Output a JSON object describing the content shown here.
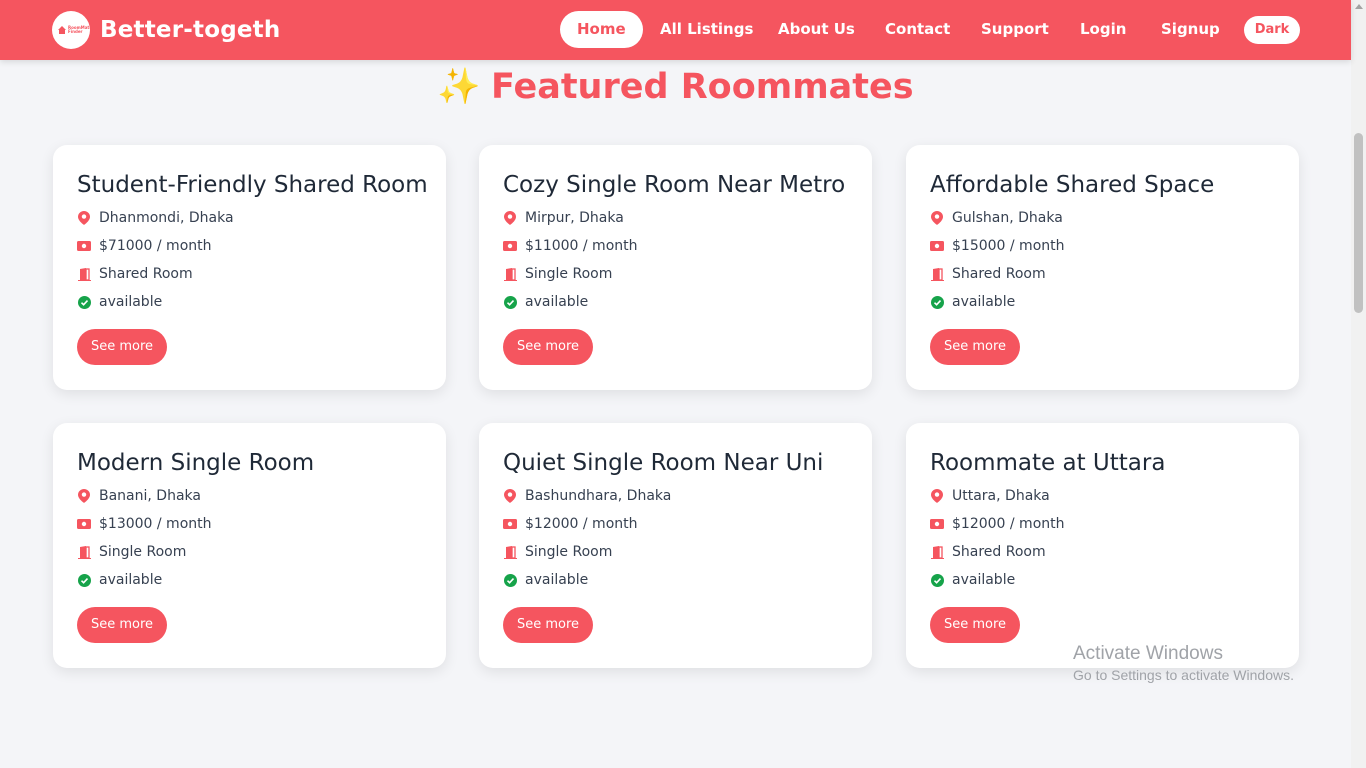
{
  "brand": {
    "name": "Better-togeth",
    "logo_text": "RoomMate Finder",
    "color": "#f5555f"
  },
  "nav": {
    "links": [
      {
        "label": "Home",
        "active": true
      },
      {
        "label": "All Listings"
      },
      {
        "label": "About Us"
      },
      {
        "label": "Contact"
      },
      {
        "label": "Support"
      },
      {
        "label": "Login"
      },
      {
        "label": "Signup"
      }
    ],
    "theme_toggle": "Dark"
  },
  "section": {
    "icon": "✨",
    "title": "Featured Roommates"
  },
  "listings": [
    {
      "title": "Student-Friendly Shared Room",
      "location": "Dhanmondi, Dhaka",
      "rent": "$71000 / month",
      "room_type": "Shared Room",
      "availability": "available",
      "button": "See more"
    },
    {
      "title": "Cozy Single Room Near Metro",
      "location": "Mirpur, Dhaka",
      "rent": "$11000 / month",
      "room_type": "Single Room",
      "availability": "available",
      "button": "See more"
    },
    {
      "title": "Affordable Shared Space",
      "location": "Gulshan, Dhaka",
      "rent": "$15000 / month",
      "room_type": "Shared Room",
      "availability": "available",
      "button": "See more"
    },
    {
      "title": "Modern Single Room",
      "location": "Banani, Dhaka",
      "rent": "$13000 / month",
      "room_type": "Single Room",
      "availability": "available",
      "button": "See more"
    },
    {
      "title": "Quiet Single Room Near Uni",
      "location": "Bashundhara, Dhaka",
      "rent": "$12000 / month",
      "room_type": "Single Room",
      "availability": "available",
      "button": "See more"
    },
    {
      "title": "Roommate at Uttara",
      "location": "Uttara, Dhaka",
      "rent": "$12000 / month",
      "room_type": "Shared Room",
      "availability": "available",
      "button": "See more"
    }
  ],
  "icons": {
    "location": "map-pin-icon",
    "rent": "money-icon",
    "room_type": "door-icon",
    "availability": "check-circle-icon"
  },
  "colors": {
    "accent": "#f5555f",
    "available": "#16a34a",
    "background": "#f4f5f8"
  },
  "watermark": {
    "title": "Activate Windows",
    "subtitle": "Go to Settings to activate Windows."
  }
}
